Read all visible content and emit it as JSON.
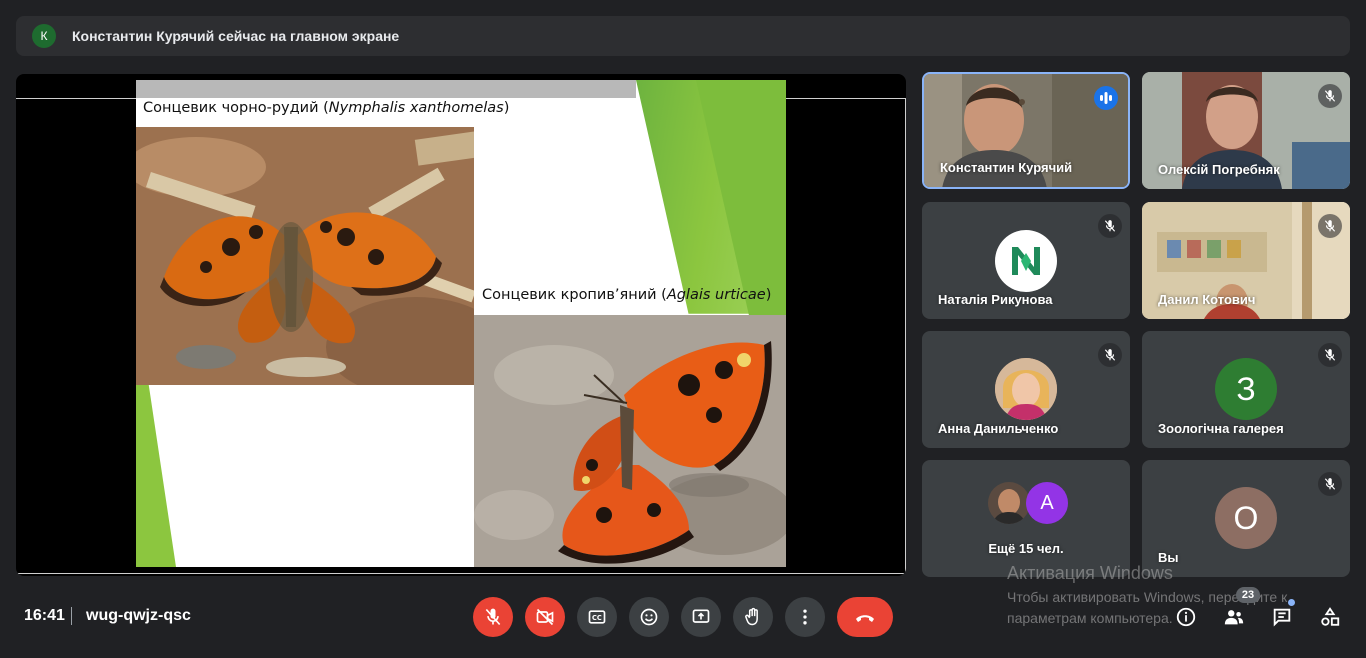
{
  "banner": {
    "avatar_letter": "К",
    "text": "Константин Курячий сейчас на главном экране"
  },
  "slide": {
    "caption1_prefix": "Сонцевик чорно-рудий (",
    "caption1_latin": "Nymphalis xanthomelas",
    "caption1_suffix": ")",
    "caption2_prefix": "Сонцевик кропив’яний (",
    "caption2_latin": "Aglais urticae",
    "caption2_suffix": ")"
  },
  "participants": [
    {
      "name": "Константин Курячий",
      "speaking": true
    },
    {
      "name": "Олексій Погребняк",
      "muted": true
    },
    {
      "name": "Наталія Рикунова",
      "muted": true,
      "avatar_letter": "N"
    },
    {
      "name": "Данил Котович",
      "muted": true
    },
    {
      "name": "Анна Данильченко",
      "muted": true
    },
    {
      "name": "Зоологічна галерея",
      "muted": true,
      "avatar_letter": "З",
      "avatar_color": "#2e7d32"
    },
    {
      "name": "Ещё 15 чел.",
      "avatar_letter": "A",
      "avatar_color": "#9334e6"
    },
    {
      "name": "Вы",
      "muted": true,
      "avatar_letter": "О",
      "avatar_color": "#8d6e63"
    }
  ],
  "bottom": {
    "time": "16:41",
    "meeting_code": "wug-qwjz-qsc",
    "people_count": "23"
  },
  "watermark": {
    "line1": "Активация Windows",
    "line2": "Чтобы активировать Windows, перейдите к параметрам компьютера."
  },
  "colors": {
    "accent": "#8ab4f8",
    "danger": "#ea4335",
    "tile_bg": "#3c4043"
  }
}
